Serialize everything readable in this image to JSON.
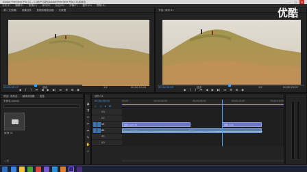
{
  "window": {
    "title": "Adobe Premiere Pro CC - C:\\用户\\文档\\Adobe\\Premiere Pro\\7.0\\未命名"
  },
  "menu": [
    "文件(F)",
    "编辑(E)",
    "剪辑(C)",
    "序列(S)",
    "标记(M)",
    "字幕(T)",
    "窗口(W)",
    "帮助(H)"
  ],
  "source_monitor": {
    "tabs": [
      "源: (无剪辑)",
      "效果控件",
      "音频剪辑混合器",
      "元数据"
    ],
    "timecode_left": "00;00;05;17",
    "timecode_right": "00;00;19;26",
    "fit": "适合",
    "page": "1/2"
  },
  "program_monitor": {
    "tab": "节目: 序列 01",
    "timecode_left": "00;00;00;00",
    "timecode_right": "00;00;25;01",
    "fit": "适合",
    "page": "1/2"
  },
  "project": {
    "tabs": [
      "项目: 未命名",
      "媒体浏览器",
      "信息"
    ],
    "path": "未命名.prproj",
    "item_label": "序列 01",
    "item_meta": "1 项"
  },
  "timeline": {
    "tab": "序列 01",
    "timecode": "00;00;00;00",
    "ruler": [
      "00;00",
      "00;00;04;00",
      "00;00;08;00",
      "00;00;12;00",
      "00;00;16;00",
      "00;00;20;00",
      "00;00;24;00",
      "00;00;28;00",
      "00;00;32;00"
    ],
    "tracks": [
      "V3",
      "V2",
      "V1",
      "A1",
      "A2",
      "A3"
    ],
    "clip_v1_a": "素材.mp4 [V]",
    "clip_v1_b": "素材.mp4",
    "playhead_fraction": 0.62
  },
  "watermark": "优酷",
  "colors": {
    "accent": "#3ca2ff",
    "video_clip": "#6b76c8",
    "audio_clip": "#5c7fb4"
  }
}
